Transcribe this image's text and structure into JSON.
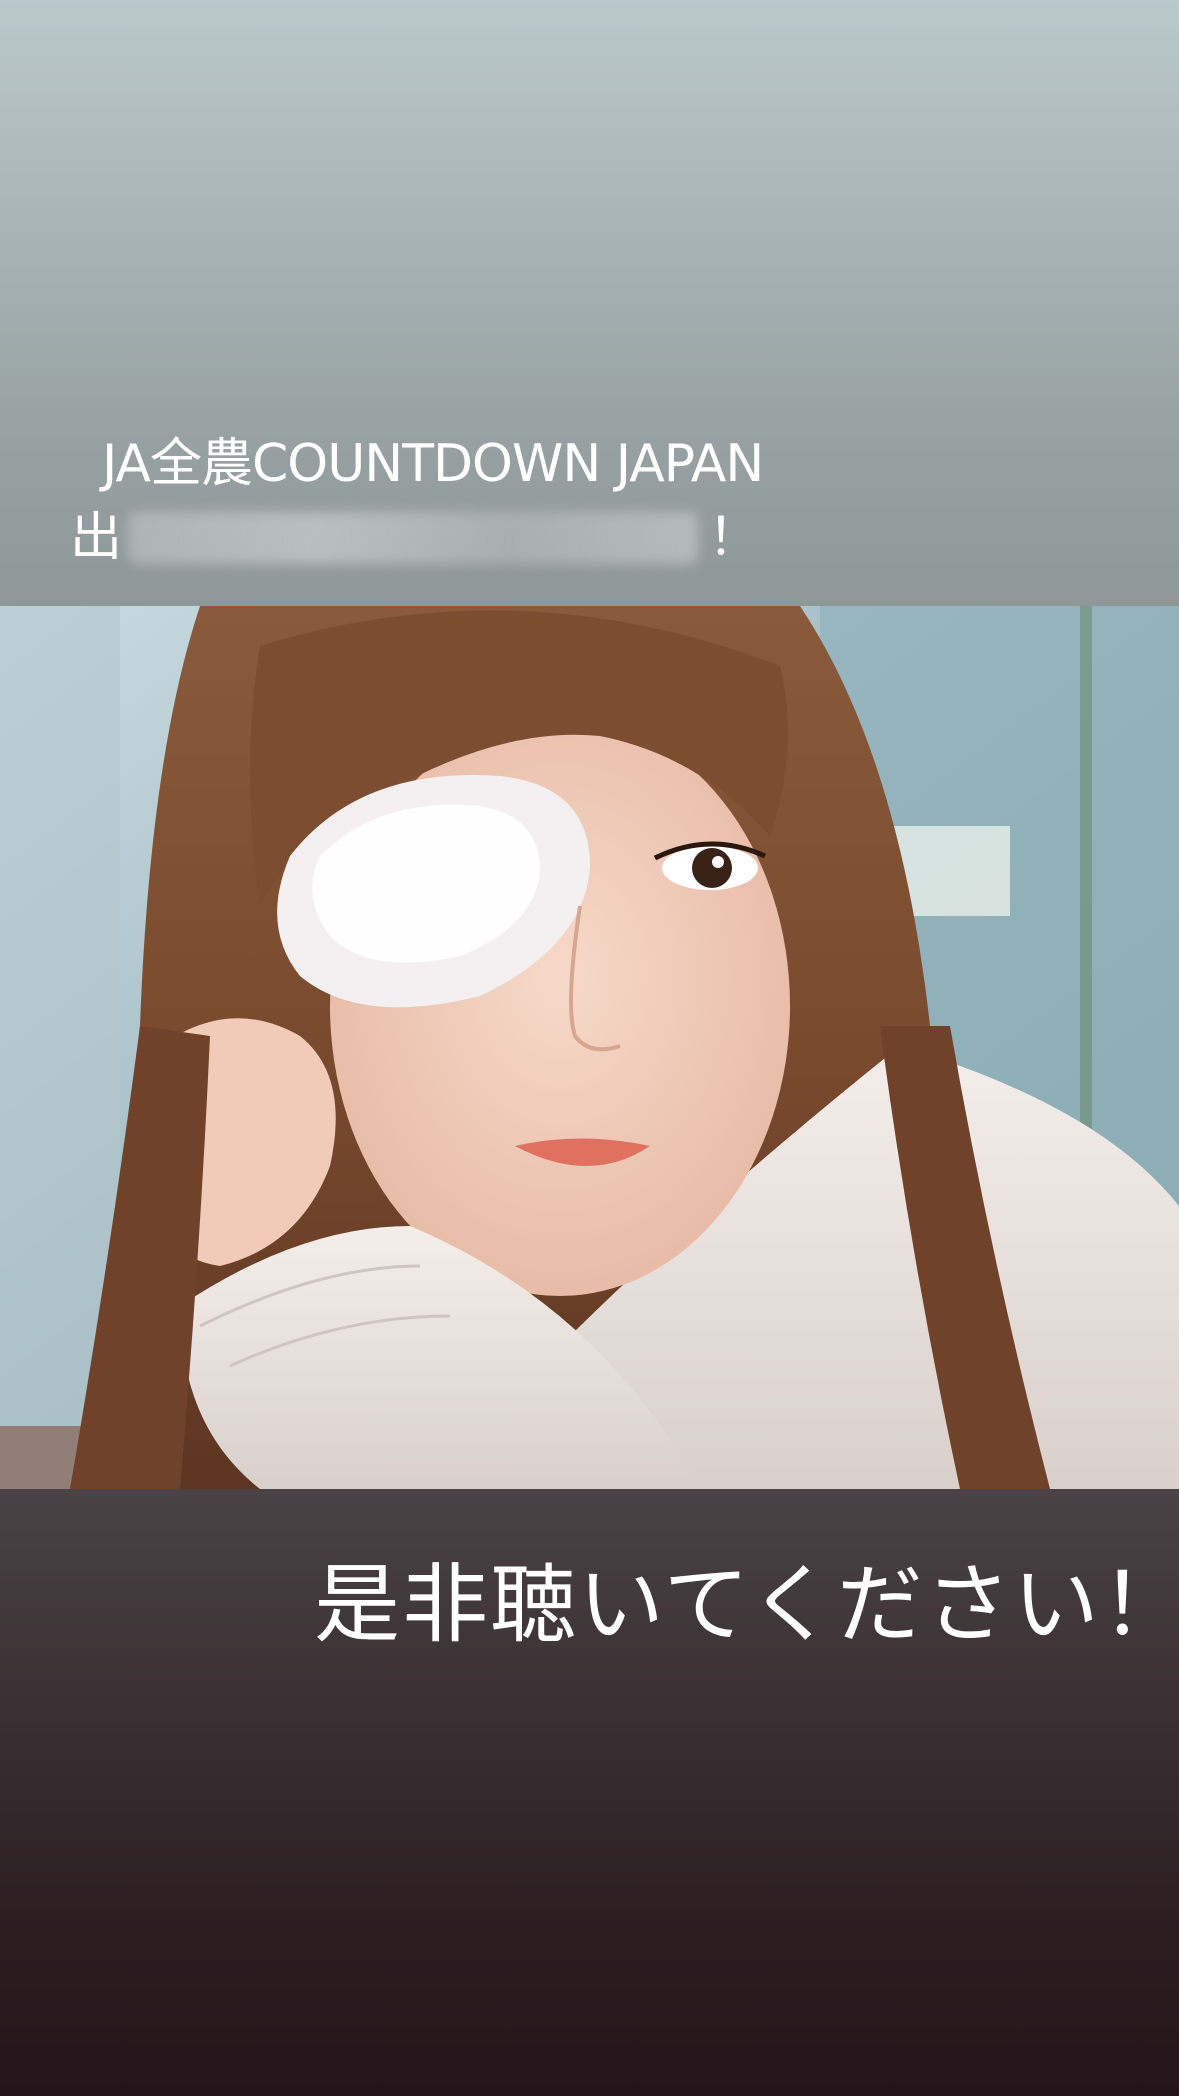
{
  "story": {
    "caption_line1": "JA全農COUNTDOWN JAPAN",
    "caption_line2_start": "出",
    "caption_line2_end": "！",
    "caption_bottom": "是非聴いてください！"
  },
  "photo": {
    "subject": "selfie-with-eyepatch"
  },
  "colors": {
    "top_gradient_start": "#b9c9cc",
    "top_gradient_end": "#8f9899",
    "bottom_gradient_start": "#4a4245",
    "bottom_gradient_end": "#22161a",
    "caption_text": "#ffffff"
  }
}
